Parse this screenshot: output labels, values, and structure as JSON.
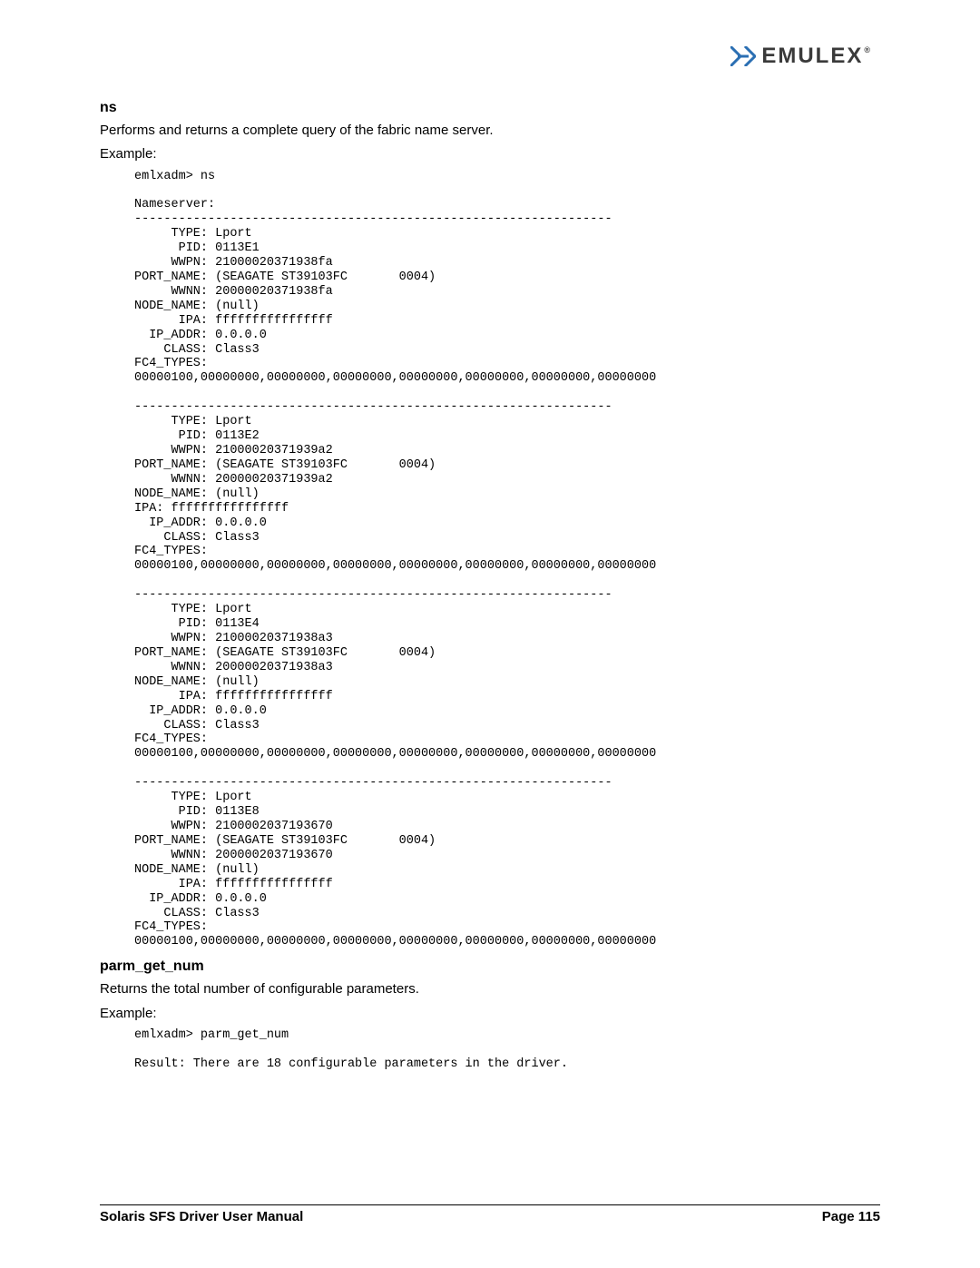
{
  "logo": {
    "text": "EMULEX",
    "reg": "®"
  },
  "ns": {
    "heading": "ns",
    "desc": "Performs and returns a complete query of the fabric name server.",
    "example_label": "Example:",
    "code": "emlxadm> ns\n\nNameserver:\n-----------------------------------------------------------------\n     TYPE: Lport\n      PID: 0113E1\n     WWPN: 21000020371938fa\nPORT_NAME: (SEAGATE ST39103FC       0004)\n     WWNN: 20000020371938fa\nNODE_NAME: (null)\n      IPA: ffffffffffffffff\n  IP_ADDR: 0.0.0.0\n    CLASS: Class3 \nFC4_TYPES: \n00000100,00000000,00000000,00000000,00000000,00000000,00000000,00000000\n\n-----------------------------------------------------------------\n     TYPE: Lport\n      PID: 0113E2\n     WWPN: 21000020371939a2\nPORT_NAME: (SEAGATE ST39103FC       0004)\n     WWNN: 20000020371939a2\nNODE_NAME: (null) \nIPA: ffffffffffffffff\n  IP_ADDR: 0.0.0.0\n    CLASS: Class3 \nFC4_TYPES: \n00000100,00000000,00000000,00000000,00000000,00000000,00000000,00000000\n\n-----------------------------------------------------------------\n     TYPE: Lport\n      PID: 0113E4\n     WWPN: 21000020371938a3\nPORT_NAME: (SEAGATE ST39103FC       0004)\n     WWNN: 20000020371938a3\nNODE_NAME: (null)\n      IPA: ffffffffffffffff\n  IP_ADDR: 0.0.0.0\n    CLASS: Class3 \nFC4_TYPES: \n00000100,00000000,00000000,00000000,00000000,00000000,00000000,00000000\n\n-----------------------------------------------------------------\n     TYPE: Lport\n      PID: 0113E8\n     WWPN: 2100002037193670\nPORT_NAME: (SEAGATE ST39103FC       0004)\n     WWNN: 2000002037193670\nNODE_NAME: (null)\n      IPA: ffffffffffffffff\n  IP_ADDR: 0.0.0.0\n    CLASS: Class3 \nFC4_TYPES: \n00000100,00000000,00000000,00000000,00000000,00000000,00000000,00000000"
  },
  "parm_get_num": {
    "heading": "parm_get_num",
    "desc": "Returns the total number of configurable parameters.",
    "example_label": "Example:",
    "code": "emlxadm> parm_get_num\n\nResult: There are 18 configurable parameters in the driver."
  },
  "footer": {
    "manual": "Solaris SFS Driver User Manual",
    "page": "Page 115"
  }
}
